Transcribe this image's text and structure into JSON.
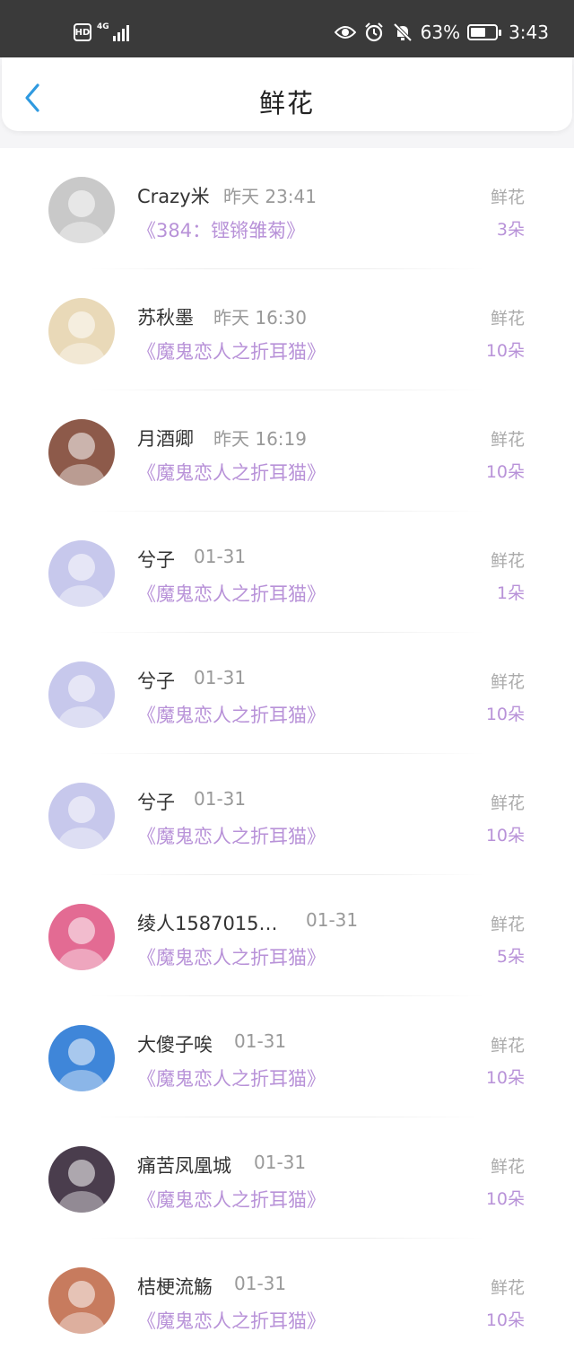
{
  "status_bar": {
    "hd": "HD",
    "network": "4G",
    "battery_percent": "63%",
    "battery_level": 0.63,
    "time": "3:43"
  },
  "header": {
    "title": "鲜花"
  },
  "rows": [
    {
      "name": "Crazy米",
      "time": "昨天 23:41",
      "book": "《384：铿锵雏菊》",
      "label": "鲜花",
      "count": "3朵",
      "avatar_color": "#c9c9c9"
    },
    {
      "name": "苏秋墨",
      "time": "昨天 16:30",
      "book": "《魔鬼恋人之折耳猫》",
      "label": "鲜花",
      "count": "10朵",
      "avatar_color": "#e9d9b8"
    },
    {
      "name": "月酒卿",
      "time": "昨天 16:19",
      "book": "《魔鬼恋人之折耳猫》",
      "label": "鲜花",
      "count": "10朵",
      "avatar_color": "#8d5a4a"
    },
    {
      "name": "兮子",
      "time": "01-31",
      "book": "《魔鬼恋人之折耳猫》",
      "label": "鲜花",
      "count": "1朵",
      "avatar_color": "#c7c8ec"
    },
    {
      "name": "兮子",
      "time": "01-31",
      "book": "《魔鬼恋人之折耳猫》",
      "label": "鲜花",
      "count": "10朵",
      "avatar_color": "#c7c8ec"
    },
    {
      "name": "兮子",
      "time": "01-31",
      "book": "《魔鬼恋人之折耳猫》",
      "label": "鲜花",
      "count": "10朵",
      "avatar_color": "#c7c8ec"
    },
    {
      "name": "绫人1587015…",
      "time": "01-31",
      "book": "《魔鬼恋人之折耳猫》",
      "label": "鲜花",
      "count": "5朵",
      "avatar_color": "#e36b93"
    },
    {
      "name": "大傻子唉",
      "time": "01-31",
      "book": "《魔鬼恋人之折耳猫》",
      "label": "鲜花",
      "count": "10朵",
      "avatar_color": "#3f86d9"
    },
    {
      "name": "痛苦凤凰城",
      "time": "01-31",
      "book": "《魔鬼恋人之折耳猫》",
      "label": "鲜花",
      "count": "10朵",
      "avatar_color": "#4a3d4d"
    },
    {
      "name": "桔梗流觞",
      "time": "01-31",
      "book": "《魔鬼恋人之折耳猫》",
      "label": "鲜花",
      "count": "10朵",
      "avatar_color": "#c77b5e"
    }
  ],
  "colors": {
    "accent_purple": "#b892d8",
    "back_arrow_blue": "#2f9ae0",
    "status_bar_bg": "#3a3a3a"
  }
}
